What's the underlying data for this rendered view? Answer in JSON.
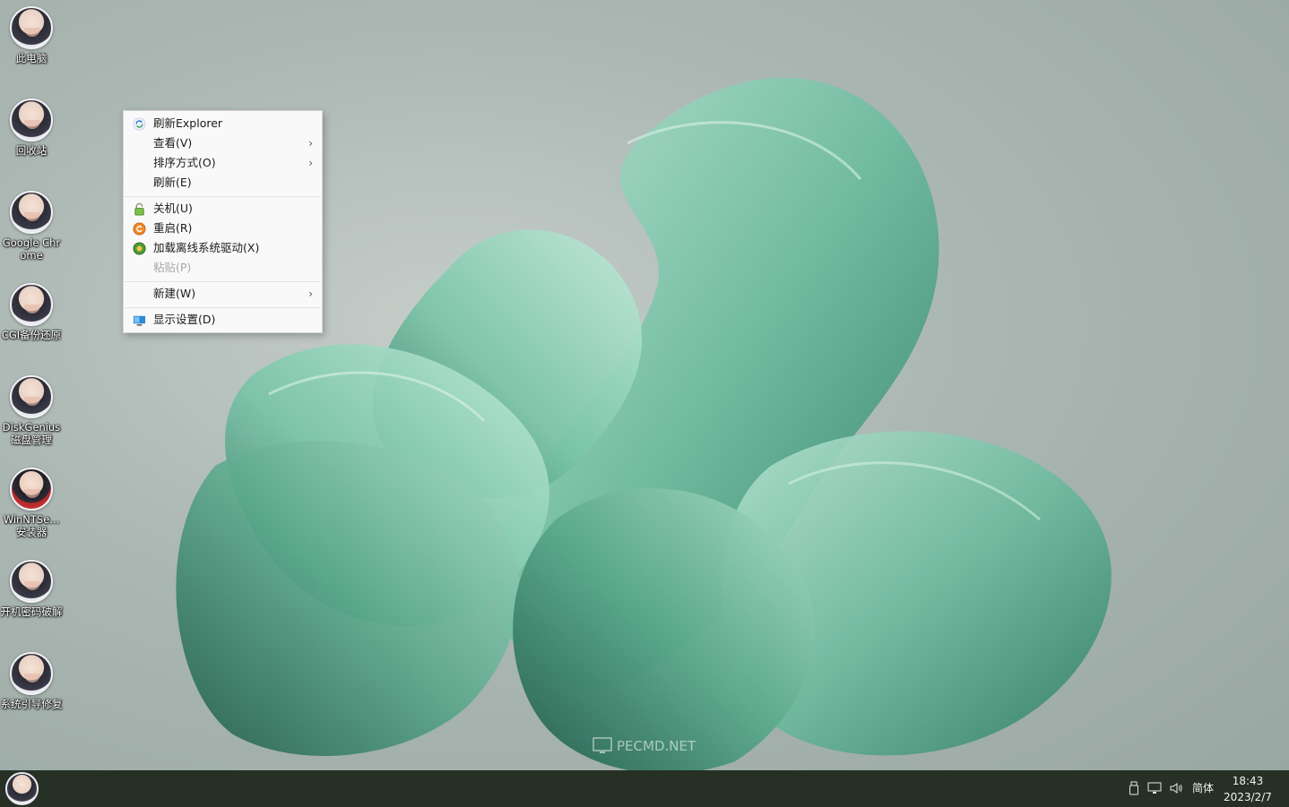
{
  "desktop": {
    "icons": [
      {
        "label": "此电脑"
      },
      {
        "label": "回收站"
      },
      {
        "label": "Google Chrome"
      },
      {
        "label": "CGI备份还原"
      },
      {
        "label": "DiskGenius磁盘管理"
      },
      {
        "label": "WinNTSe...安装器"
      },
      {
        "label": "开机密码破解"
      },
      {
        "label": "系统引导修复"
      }
    ],
    "watermark": "PECMD.NET"
  },
  "context_menu": {
    "items": [
      {
        "label": "刷新Explorer",
        "icon": "refresh-icon"
      },
      {
        "label": "查看(V)",
        "submenu": true
      },
      {
        "label": "排序方式(O)",
        "submenu": true
      },
      {
        "label": "刷新(E)"
      },
      {
        "label": "关机(U)",
        "icon": "lock-icon"
      },
      {
        "label": "重启(R)",
        "icon": "restart-icon"
      },
      {
        "label": "加载离线系统驱动(X)",
        "icon": "driver-icon"
      },
      {
        "label": "粘贴(P)",
        "disabled": true
      },
      {
        "label": "新建(W)",
        "submenu": true
      },
      {
        "label": "显示设置(D)",
        "icon": "display-icon"
      }
    ]
  },
  "taskbar": {
    "ime": "简体",
    "time": "18:43",
    "date": "2023/2/7",
    "tray_icons": [
      "usb-icon",
      "network-icon",
      "volume-icon"
    ]
  },
  "colors": {
    "taskbar": "#263024",
    "wallpaper_accent": "#5fae93",
    "menu_bg": "#f9f9f9"
  }
}
